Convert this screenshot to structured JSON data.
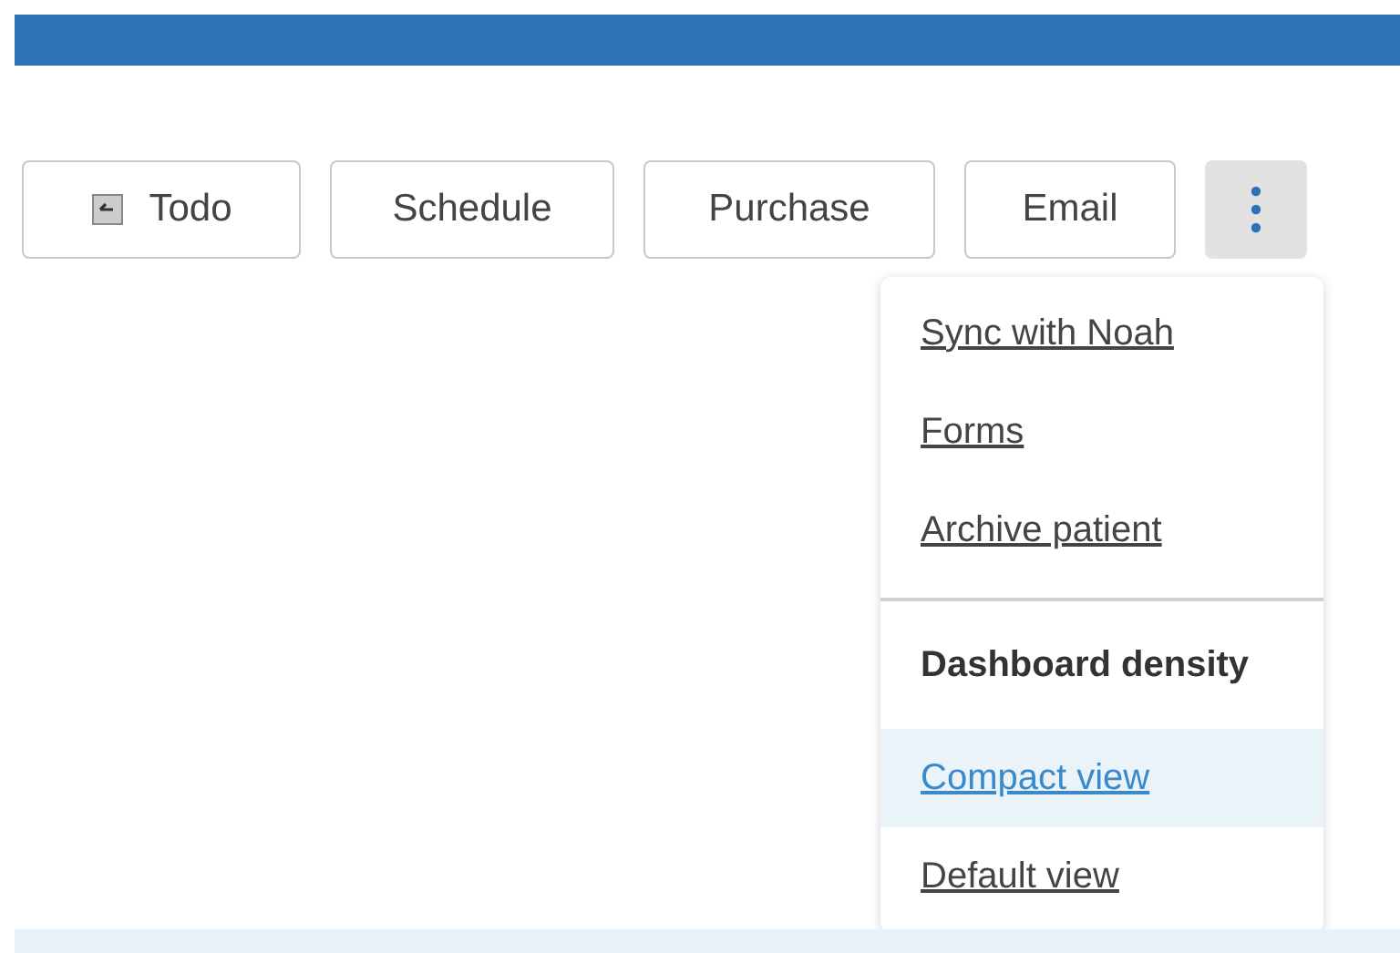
{
  "toolbar": {
    "buttons": [
      {
        "label": "Todo",
        "kind": "icon"
      },
      {
        "label": "Schedule",
        "kind": "plain"
      },
      {
        "label": "Purchase",
        "kind": "plain"
      },
      {
        "label": "Email",
        "kind": "plain"
      }
    ]
  },
  "more_button": {
    "expanded": true
  },
  "menu": {
    "actions": [
      "Sync with Noah",
      "Forms",
      "Archive patient"
    ],
    "header": "Dashboard density",
    "options": [
      {
        "label": "Compact view",
        "selected": true
      },
      {
        "label": "Default view",
        "selected": false
      }
    ]
  }
}
